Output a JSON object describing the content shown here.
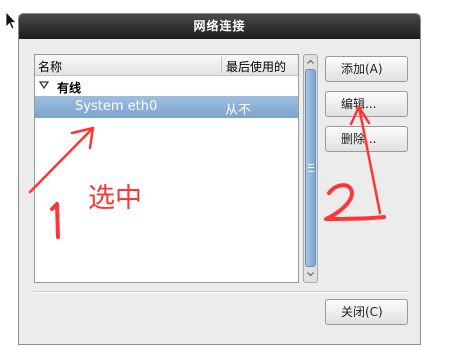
{
  "window": {
    "title": "网络连接"
  },
  "connection_list": {
    "columns": [
      "名称",
      "最后使用的"
    ],
    "groups": [
      {
        "label": "有线",
        "connections": [
          {
            "name": "System eth0",
            "last_used": "从不",
            "selected": true
          }
        ]
      }
    ]
  },
  "buttons": {
    "add": "添加(A)",
    "edit": "编辑...",
    "delete": "删除...",
    "close": "关闭(C)"
  },
  "annotations": {
    "text": "选中",
    "step_1": "1",
    "step_2": "2",
    "color": "#ff3535"
  },
  "colors": {
    "selection": "#7ca4cf",
    "titlebar": "#2a2a2a"
  }
}
